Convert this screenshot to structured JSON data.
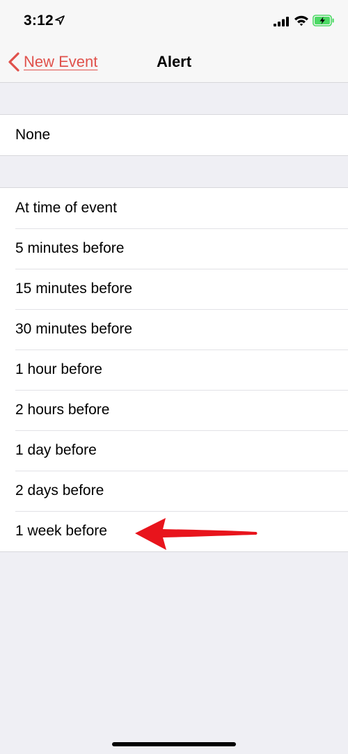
{
  "status_bar": {
    "time": "3:12",
    "icons": [
      "location-arrow-icon",
      "cellular-signal-icon",
      "wifi-icon",
      "battery-charging-icon"
    ]
  },
  "nav": {
    "back_label": "New Event",
    "title": "Alert",
    "accent_color": "#e0514b"
  },
  "group_none": {
    "items": [
      {
        "label": "None"
      }
    ]
  },
  "group_options": {
    "items": [
      {
        "label": "At time of event"
      },
      {
        "label": "5 minutes before"
      },
      {
        "label": "15 minutes before"
      },
      {
        "label": "30 minutes before"
      },
      {
        "label": "1 hour before"
      },
      {
        "label": "2 hours before"
      },
      {
        "label": "1 day before"
      },
      {
        "label": "2 days before"
      },
      {
        "label": "1 week before"
      }
    ]
  },
  "annotation": {
    "icon": "red-arrow-icon",
    "color": "#e8141c"
  }
}
